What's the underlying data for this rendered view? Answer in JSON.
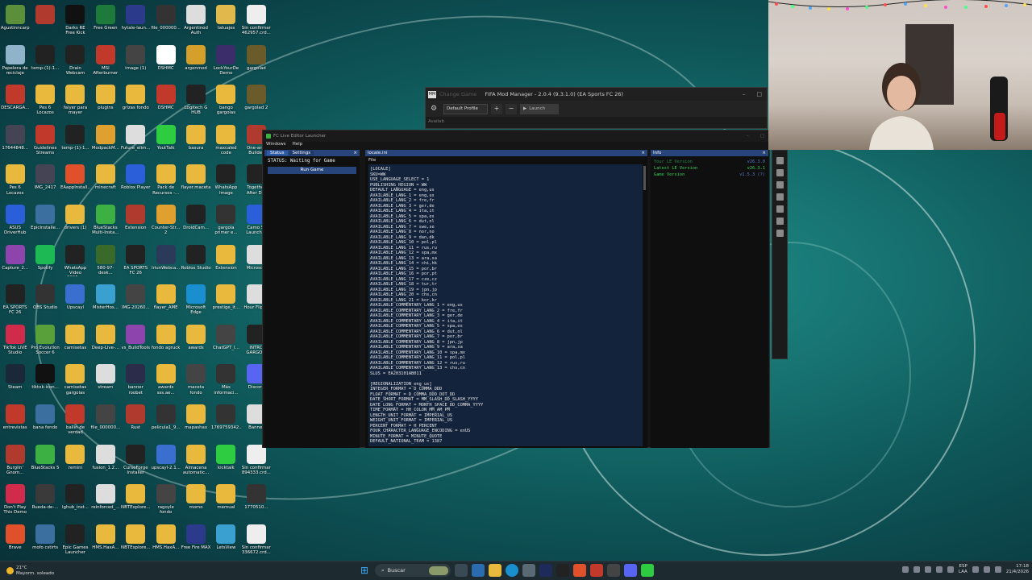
{
  "desktop": {
    "icons": [
      {
        "label": "Agustinncarp",
        "color": "#5b8f3a"
      },
      {
        "label": "",
        "color": "#b03a2e"
      },
      {
        "label": "Darks RE Free Kick",
        "color": "#111"
      },
      {
        "label": "Free Green",
        "color": "#1d7a3a"
      },
      {
        "label": "hytale-laun...",
        "color": "#2b3a8a"
      },
      {
        "label": "file_000000...",
        "color": "#333"
      },
      {
        "label": "Argentinod Auth",
        "color": "#ddd"
      },
      {
        "label": "tatuajes",
        "color": "#e0b84b"
      },
      {
        "label": "Sin confirmar 462957.crd...",
        "color": "#eee"
      },
      {
        "label": "Papelera de reciclaje",
        "color": "#8fb3c9"
      },
      {
        "label": "temp-(1)-1...",
        "color": "#222"
      },
      {
        "label": "Drain Webcam",
        "color": "#222"
      },
      {
        "label": "MSI Afterburner",
        "color": "#c0392b"
      },
      {
        "label": "image (1)",
        "color": "#444"
      },
      {
        "label": "DSHMC",
        "color": "#fff"
      },
      {
        "label": "argenmod",
        "color": "#d4a02b"
      },
      {
        "label": "LockYourDe Demo",
        "color": "#3a2d6a"
      },
      {
        "label": "gargolad",
        "color": "#6b5a2a"
      },
      {
        "label": "DESCARGA...",
        "color": "#c0392b"
      },
      {
        "label": "Pes 6 Locazos",
        "color": "#e8b93c"
      },
      {
        "label": "falyer para mayer",
        "color": "#e8b93c"
      },
      {
        "label": "plugins",
        "color": "#e8b93c"
      },
      {
        "label": "grizas fondo",
        "color": "#e8b93c"
      },
      {
        "label": "DSHMC",
        "color": "#c0392b"
      },
      {
        "label": "Logitech G HUB",
        "color": "#222"
      },
      {
        "label": "bango gargolas",
        "color": "#e8b93c"
      },
      {
        "label": "gargolad 2",
        "color": "#6b5a2a"
      },
      {
        "label": "17644848...",
        "color": "#445"
      },
      {
        "label": "Guidelines Streams",
        "color": "#c0392b"
      },
      {
        "label": "temp-(1)-1...",
        "color": "#222"
      },
      {
        "label": "ModpackM...",
        "color": "#e0a030"
      },
      {
        "label": "Future_elim...",
        "color": "#ddd"
      },
      {
        "label": "YoutTalk",
        "color": "#2ecc40"
      },
      {
        "label": "basura",
        "color": "#e8b93c"
      },
      {
        "label": "maxcaled code",
        "color": "#e8b93c"
      },
      {
        "label": "One-arm Builder",
        "color": "#b03a2e"
      },
      {
        "label": "Pes 6 Locazos",
        "color": "#e8b93c"
      },
      {
        "label": "IMG_2417",
        "color": "#445"
      },
      {
        "label": "EAappInstall...",
        "color": "#e0502b"
      },
      {
        "label": "minecraft",
        "color": "#e8b93c"
      },
      {
        "label": "Roblox Player",
        "color": "#2b5fd9"
      },
      {
        "label": "Pack de Recursos -...",
        "color": "#e8b93c"
      },
      {
        "label": "flayer.maceta",
        "color": "#e8b93c"
      },
      {
        "label": "WhatsApp Image 2026...",
        "color": "#222"
      },
      {
        "label": "Together After D...",
        "color": "#222"
      },
      {
        "label": "ASUS DriverHub",
        "color": "#2b5fd9"
      },
      {
        "label": "EpicInstalle...",
        "color": "#3a6fa0"
      },
      {
        "label": "drivers (1)",
        "color": "#e8b93c"
      },
      {
        "label": "BlueStacks Multi-Insta...",
        "color": "#3cb043"
      },
      {
        "label": "Extension",
        "color": "#b03a2e"
      },
      {
        "label": "Counter-Str... 2",
        "color": "#e0a030"
      },
      {
        "label": "DroidCam...",
        "color": "#222"
      },
      {
        "label": "gargola primer e...",
        "color": "#333"
      },
      {
        "label": "Camo St Launcher",
        "color": "#2b5fd9"
      },
      {
        "label": "Capture_2...",
        "color": "#8e44ad"
      },
      {
        "label": "Spotify",
        "color": "#1db954"
      },
      {
        "label": "WhatsApp Video 2025-...",
        "color": "#222"
      },
      {
        "label": "580-97-desk...",
        "color": "#3a6a2a"
      },
      {
        "label": "EA SPORTS FC 26",
        "color": "#222"
      },
      {
        "label": "IriunWebca...",
        "color": "#2b3a5a"
      },
      {
        "label": "Roblox Studio",
        "color": "#222"
      },
      {
        "label": "Extension",
        "color": "#e8b93c"
      },
      {
        "label": "Microsoft",
        "color": "#ddd"
      },
      {
        "label": "EA SPORTS FC 26",
        "color": "#222"
      },
      {
        "label": "OBS Studio",
        "color": "#333"
      },
      {
        "label": "Upscayl",
        "color": "#3a6fd0"
      },
      {
        "label": "MisterHos...",
        "color": "#3aa0d0"
      },
      {
        "label": "IMG-20260...",
        "color": "#444"
      },
      {
        "label": "flayer_AME",
        "color": "#e8b93c"
      },
      {
        "label": "Microsoft Edge",
        "color": "#1a8fd0"
      },
      {
        "label": "prestige_it...",
        "color": "#e8b93c"
      },
      {
        "label": "Hour Flippe",
        "color": "#ddd"
      },
      {
        "label": "TikTok LIVE Studio",
        "color": "#d02b4a"
      },
      {
        "label": "Pro Evolution Soccer 6",
        "color": "#5aa03a"
      },
      {
        "label": "camisetas",
        "color": "#e8b93c"
      },
      {
        "label": "Deep-Live-...",
        "color": "#e8b93c"
      },
      {
        "label": "vs_BuildTools",
        "color": "#8e44ad"
      },
      {
        "label": "fondo agruck",
        "color": "#e8b93c"
      },
      {
        "label": "awards",
        "color": "#e8b93c"
      },
      {
        "label": "ChatGPT_I...",
        "color": "#444"
      },
      {
        "label": "INTRO GARGO...",
        "color": "#222"
      },
      {
        "label": "Steam",
        "color": "#1b2838"
      },
      {
        "label": "tiktok-icon...",
        "color": "#111"
      },
      {
        "label": "camisetas gargolas",
        "color": "#e8b93c"
      },
      {
        "label": "stream",
        "color": "#ddd"
      },
      {
        "label": "banner roobet",
        "color": "#2b2b4a"
      },
      {
        "label": "awards sss.ae...",
        "color": "#e8b93c"
      },
      {
        "label": "maceta fondo",
        "color": "#444"
      },
      {
        "label": "Más informaci...",
        "color": "#333"
      },
      {
        "label": "Discord",
        "color": "#5865f2"
      },
      {
        "label": "entrevistas",
        "color": "#c0392b"
      },
      {
        "label": "bana fondo",
        "color": "#3a6fa0"
      },
      {
        "label": "ballin de verdad",
        "color": "#c0392b"
      },
      {
        "label": "file_000000...",
        "color": "#444"
      },
      {
        "label": "Rust",
        "color": "#b03a2e"
      },
      {
        "label": "pelicula1_9...",
        "color": "#333"
      },
      {
        "label": "mapashax",
        "color": "#e8b93c"
      },
      {
        "label": "1769759342...",
        "color": "#333"
      },
      {
        "label": "Banner",
        "color": "#ddd"
      },
      {
        "label": "Burglin' Gnom...",
        "color": "#b03a2e"
      },
      {
        "label": "BlueStacks 5",
        "color": "#3cb043"
      },
      {
        "label": "remini",
        "color": "#e8b93c"
      },
      {
        "label": "fusion_1.2...",
        "color": "#ddd"
      },
      {
        "label": "CurseForge Installer",
        "color": "#222"
      },
      {
        "label": "upscayl-2.1...",
        "color": "#3a6fd0"
      },
      {
        "label": "Almacena automatic...",
        "color": "#e8b93c"
      },
      {
        "label": "kicktalk",
        "color": "#2ecc40"
      },
      {
        "label": "Sin confirmar 894333.crd...",
        "color": "#eee"
      },
      {
        "label": "Don't Play This Demo",
        "color": "#d02b4a"
      },
      {
        "label": "Rueda-de-...",
        "color": "#3a3a3a"
      },
      {
        "label": "lghub_inst...",
        "color": "#222"
      },
      {
        "label": "reinforced_...",
        "color": "#ddd"
      },
      {
        "label": "NBTExplore...",
        "color": "#e8b93c"
      },
      {
        "label": "ragoyle fondo",
        "color": "#444"
      },
      {
        "label": "momo",
        "color": "#e8b93c"
      },
      {
        "label": "memual",
        "color": "#e8b93c"
      },
      {
        "label": "1770510...",
        "color": "#333"
      },
      {
        "label": "Brave",
        "color": "#e0502b"
      },
      {
        "label": "mofo cstirts",
        "color": "#3a6fa0"
      },
      {
        "label": "Epic Games Launcher",
        "color": "#222"
      },
      {
        "label": "HMS.HaxA...",
        "color": "#e8b93c"
      },
      {
        "label": "NBTExplore...",
        "color": "#e8b93c"
      },
      {
        "label": "HMS.HaxA...",
        "color": "#e8b93c"
      },
      {
        "label": "Free Fire MAX",
        "color": "#2b3a8a"
      },
      {
        "label": "LetsView",
        "color": "#3aa0d0"
      },
      {
        "label": "Sin confirmar 336672.crd...",
        "color": "#eee"
      }
    ]
  },
  "fmm": {
    "title": "FIFA Mod Manager - 2.0.4 (9.3.1.0) (EA Sports FC 26)",
    "ghost_title": "Change Game",
    "logo": "MM",
    "profile": "Default Profile",
    "add": "+",
    "remove": "−",
    "launch": "Launch",
    "available": "Availab"
  },
  "fcl": {
    "title": "FC Live Editor Launcher",
    "menu": [
      "Windows",
      "Help"
    ],
    "status_panel": {
      "tabs": [
        "Status",
        "Settings"
      ],
      "status": "STATUS: Waiting for Game",
      "run_button": "Run Game"
    },
    "locale_panel": {
      "tab": "locale.ini",
      "menu_file": "File",
      "lines": [
        "[LOCALE]",
        "SKU=WW",
        "USE_LANGUAGE_SELECT = 1",
        "PUBLISHING_REGION = WW",
        "DEFAULT_LANGUAGE = eng,us",
        "AVAILABLE_LANG_1 = eng,us",
        "AVAILABLE_LANG_2 = fre,fr",
        "AVAILABLE_LANG_3 = ger,de",
        "AVAILABLE_LANG_4 = ita,it",
        "AVAILABLE_LANG_5 = spa,es",
        "AVAILABLE_LANG_6 = dut,nl",
        "AVAILABLE_LANG_7 = swe,se",
        "AVAILABLE_LANG_8 = nor,no",
        "AVAILABLE_LANG_9 = dan,dk",
        "AVAILABLE_LANG_10 = pol,pl",
        "AVAILABLE_LANG_11 = rus,ru",
        "AVAILABLE_LANG_12 = spa,mx",
        "AVAILABLE_LANG_13 = ara,sa",
        "AVAILABLE_LANG_14 = chi,hk",
        "AVAILABLE_LANG_15 = por,br",
        "AVAILABLE_LANG_16 = por,pt",
        "AVAILABLE_LANG_17 = cze,cz",
        "AVAILABLE_LANG_18 = tur,tr",
        "AVAILABLE_LANG_19 = jpn,jp",
        "AVAILABLE_LANG_20 = chs,cn",
        "AVAILABLE_LANG_21 = kor,kr",
        "AVAILABLE_COMMENTARY_LANG_1 = eng,us",
        "AVAILABLE_COMMENTARY_LANG_2 = fre,fr",
        "AVAILABLE_COMMENTARY_LANG_3 = ger,de",
        "AVAILABLE_COMMENTARY_LANG_4 = ita,it",
        "AVAILABLE_COMMENTARY_LANG_5 = spa,es",
        "AVAILABLE_COMMENTARY_LANG_6 = dut,nl",
        "AVAILABLE_COMMENTARY_LANG_7 = por,br",
        "AVAILABLE_COMMENTARY_LANG_8 = jpn,jp",
        "AVAILABLE_COMMENTARY_LANG_9 = ara,sa",
        "AVAILABLE_COMMENTARY_LANG_10 = spa,mx",
        "AVAILABLE_COMMENTARY_LANG_11 = pol,pl",
        "AVAILABLE_COMMENTARY_LANG_12 = rus,ru",
        "AVAILABLE_COMMENTARY_LANG_13 = chs,cn",
        "SLUS = EA203101AB011",
        "",
        "[REGIONALIZATION_eng_us]",
        "INTEGER_FORMAT = D_COMMA_DDD",
        "FLOAT_FORMAT = D_COMMA_DDD_DOT_DD",
        "DATE_SHORT_FORMAT = MM_SLASH_DD_SLASH_YYYY",
        "DATE_LONG_FORMAT = MONTH_SPACE_DD_COMMA_YYYY",
        "TIME_FORMAT = HH_COLON_MM_AM_PM",
        "LENGTH_UNIT_FORMAT = IMPERIAL_US",
        "WEIGHT_UNIT_FORMAT = IMPERIAL_US",
        "PERCENT_FORMAT = H_PERCENT",
        "FOUR_CHARACTER_LANGUAGE_ENCODING = enUS",
        "MINUTE_FORMAT = MINUTE_QUOTE",
        "DEFAULT_NATIONAL_TEAM = 1387"
      ]
    },
    "info_panel": {
      "tab": "Info",
      "rows": [
        {
          "label": "Your LE Version",
          "value": "v26.3.0"
        },
        {
          "label": "Latest LE Version",
          "value": "v26.3.1"
        },
        {
          "label": "Game Version",
          "value": "v1.5.3 (?)"
        }
      ]
    }
  },
  "taskbar": {
    "weather_temp": "21°C",
    "weather_text": "Mayorm. soleado",
    "search_placeholder": "Buscar",
    "lang_1": "ESP",
    "lang_2": "LAA",
    "time": "17:18",
    "date": "21/4/2026"
  }
}
